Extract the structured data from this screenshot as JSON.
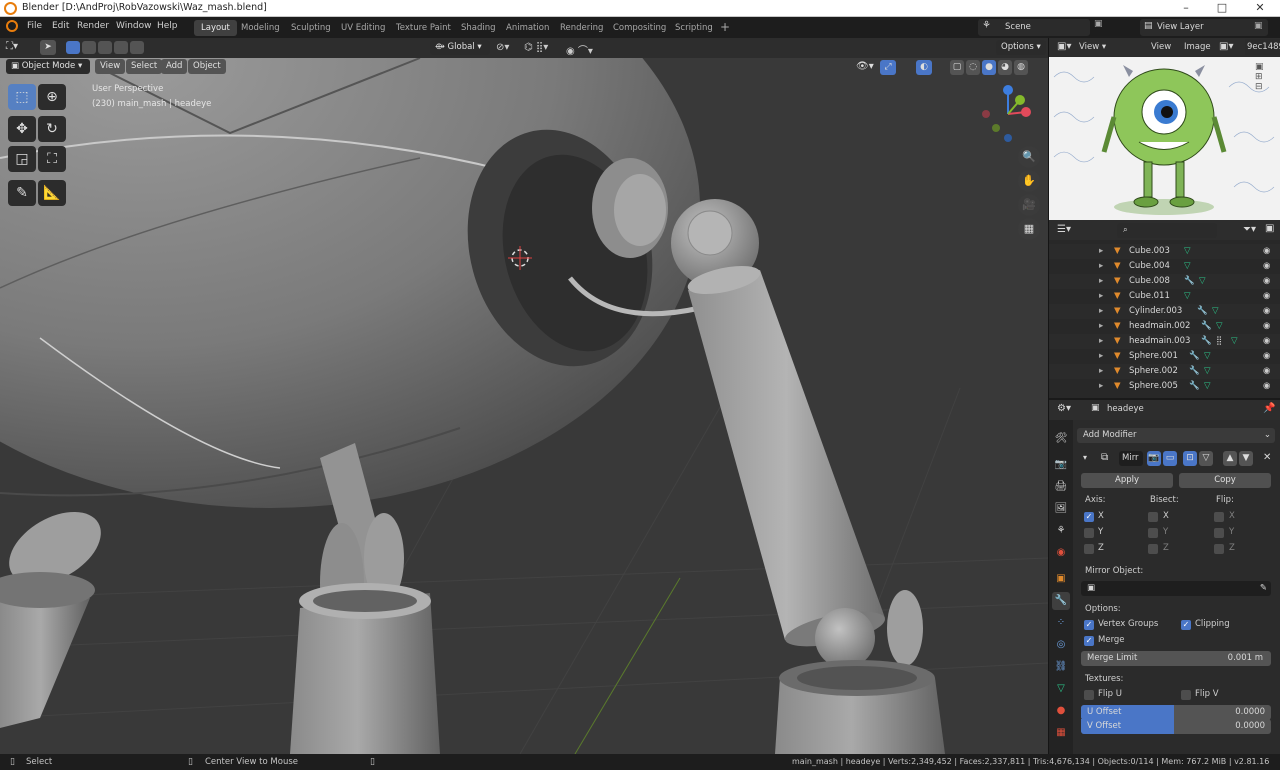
{
  "window": {
    "title": "Blender [D:\\AndProj\\RobVazowski\\Waz_mash.blend]"
  },
  "menus": [
    "File",
    "Edit",
    "Render",
    "Window",
    "Help"
  ],
  "workspaces": [
    "Layout",
    "Modeling",
    "Sculpting",
    "UV Editing",
    "Texture Paint",
    "Shading",
    "Animation",
    "Rendering",
    "Compositing",
    "Scripting"
  ],
  "active_workspace": "Layout",
  "scene": {
    "name": "Scene",
    "view_layer": "View Layer"
  },
  "viewport": {
    "transform_orientation": "Global",
    "mode": "Object Mode",
    "menu": [
      "View",
      "Select",
      "Add",
      "Object"
    ],
    "options_label": "Options",
    "perspective_label": "User Perspective",
    "object_label": "(230) main_mash | headeye",
    "gizmo_axes": {
      "x": "X",
      "y": "Y",
      "z": "Z"
    }
  },
  "tools": {
    "select": "select-box-icon",
    "cursor": "cursor-icon",
    "move": "move-icon",
    "rotate": "rotate-icon",
    "scale": "scale-icon",
    "transform": "transform-icon",
    "annotate": "annotate-icon",
    "measure": "measure-icon"
  },
  "image_editor": {
    "menu": [
      "View",
      "View",
      "Image"
    ],
    "image_name": "9ec1489"
  },
  "outliner": {
    "rows": [
      {
        "name": "Cube.003"
      },
      {
        "name": "Cube.004"
      },
      {
        "name": "Cube.008"
      },
      {
        "name": "Cube.011"
      },
      {
        "name": "Cylinder.003"
      },
      {
        "name": "headmain.002"
      },
      {
        "name": "headmain.003"
      },
      {
        "name": "Sphere.001"
      },
      {
        "name": "Sphere.002"
      },
      {
        "name": "Sphere.005"
      }
    ]
  },
  "properties": {
    "object_name": "headeye",
    "add_modifier": "Add Modifier",
    "modifier_name": "Mirr",
    "apply_label": "Apply",
    "copy_label": "Copy",
    "axis_header": "Axis:",
    "bisect_header": "Bisect:",
    "flip_header": "Flip:",
    "axis": {
      "x": "X",
      "y": "Y",
      "z": "Z"
    },
    "mirror_object_label": "Mirror Object:",
    "options_header": "Options:",
    "vertex_groups_label": "Vertex Groups",
    "clipping_label": "Clipping",
    "merge_label": "Merge",
    "merge_limit_label": "Merge Limit",
    "merge_limit_value": "0.001 m",
    "textures_header": "Textures:",
    "flip_u_label": "Flip U",
    "flip_v_label": "Flip V",
    "u_offset_label": "U Offset",
    "u_offset_value": "0.0000",
    "v_offset_label": "V Offset",
    "v_offset_value": "0.0000"
  },
  "statusbar": {
    "select": "Select",
    "center_view": "Center View to Mouse",
    "stats": "main_mash | headeye | Verts:2,349,452 | Faces:2,337,811 | Tris:4,676,134 | Objects:0/114 | Mem: 767.2 MiB | v2.81.16"
  },
  "colors": {
    "accent": "#4a76c7",
    "modifier_blue": "#4a76c7",
    "object_orange": "#e08a2c",
    "mesh_green": "#2bc58a",
    "axis_x": "#e24a5b",
    "axis_y": "#84b92b",
    "axis_z": "#3d7ee0"
  }
}
